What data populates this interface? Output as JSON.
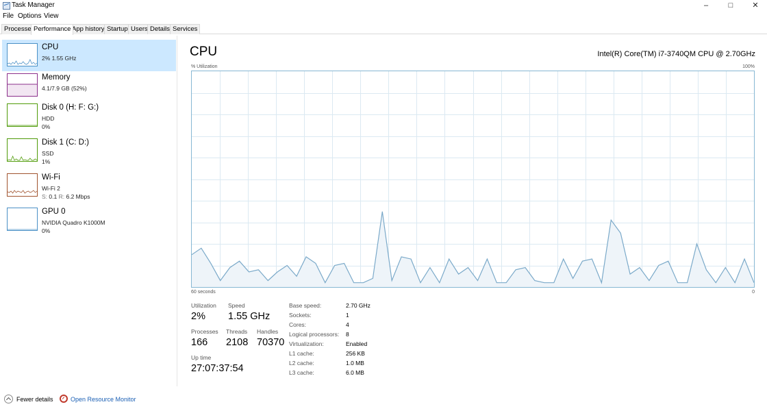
{
  "window": {
    "title": "Task Manager",
    "minimize": "–",
    "maximize": "□",
    "close": "✕"
  },
  "menu": {
    "items": [
      "File",
      "Options",
      "View"
    ]
  },
  "tabs": [
    "Processes",
    "Performance",
    "App history",
    "Startup",
    "Users",
    "Details",
    "Services"
  ],
  "active_tab": "Performance",
  "sidebar": {
    "items": [
      {
        "name": "CPU",
        "line1": "2% 1.55 GHz",
        "line2": "",
        "color": "#4a90c6",
        "selected": true
      },
      {
        "name": "Memory",
        "line1": "4.1/7.9 GB (52%)",
        "line2": "",
        "color": "#8b2f8b",
        "selected": false
      },
      {
        "name": "Disk 0 (H: F: G:)",
        "line1": "HDD",
        "line2": "0%",
        "color": "#4e9a06",
        "selected": false
      },
      {
        "name": "Disk 1 (C: D:)",
        "line1": "SSD",
        "line2": "1%",
        "color": "#4e9a06",
        "selected": false
      },
      {
        "name": "Wi-Fi",
        "line1": "Wi-Fi 2",
        "line2_send_label": "S:",
        "line2_send": "0.1",
        "line2_recv_label": "R:",
        "line2_recv": "6.2 Mbps",
        "color": "#a0522d",
        "selected": false
      },
      {
        "name": "GPU 0",
        "line1": "NVIDIA Quadro K1000M",
        "line2": "0%",
        "color": "#4a90c6",
        "selected": false
      }
    ]
  },
  "main": {
    "title": "CPU",
    "model": "Intel(R) Core(TM) i7-3740QM CPU @ 2.70GHz",
    "axis_label": "% Utilization",
    "axis_max": "100%",
    "time_label": "60 seconds",
    "time_end": "0",
    "stats": {
      "utilization_label": "Utilization",
      "utilization": "2%",
      "speed_label": "Speed",
      "speed": "1.55 GHz",
      "processes_label": "Processes",
      "processes": "166",
      "threads_label": "Threads",
      "threads": "2108",
      "handles_label": "Handles",
      "handles": "70370",
      "uptime_label": "Up time",
      "uptime": "27:07:37:54"
    },
    "details": [
      {
        "label": "Base speed:",
        "value": "2.70 GHz"
      },
      {
        "label": "Sockets:",
        "value": "1"
      },
      {
        "label": "Cores:",
        "value": "4"
      },
      {
        "label": "Logical processors:",
        "value": "8"
      },
      {
        "label": "Virtualization:",
        "value": "Enabled"
      },
      {
        "label": "L1 cache:",
        "value": "256 KB"
      },
      {
        "label": "L2 cache:",
        "value": "1.0 MB"
      },
      {
        "label": "L3 cache:",
        "value": "6.0 MB"
      }
    ],
    "graph": {
      "line_color": "#7aa9c9",
      "fill_color": "#eef4f9",
      "grid_color": "#dbe9f2",
      "utilization_percent": [
        15,
        18,
        11,
        3,
        9,
        12,
        7,
        8,
        3,
        7,
        10,
        5,
        14,
        11,
        2,
        10,
        11,
        2,
        2,
        4,
        35,
        3,
        14,
        13,
        2,
        9,
        2,
        13,
        6,
        9,
        3,
        13,
        2,
        2,
        8,
        9,
        3,
        2,
        2,
        13,
        4,
        12,
        13,
        2,
        31,
        25,
        6,
        9,
        3,
        10,
        12,
        2,
        2,
        20,
        8,
        2,
        9,
        2,
        13,
        2
      ]
    }
  },
  "footer": {
    "fewer_details": "Fewer details",
    "resource_monitor": "Open Resource Monitor"
  }
}
